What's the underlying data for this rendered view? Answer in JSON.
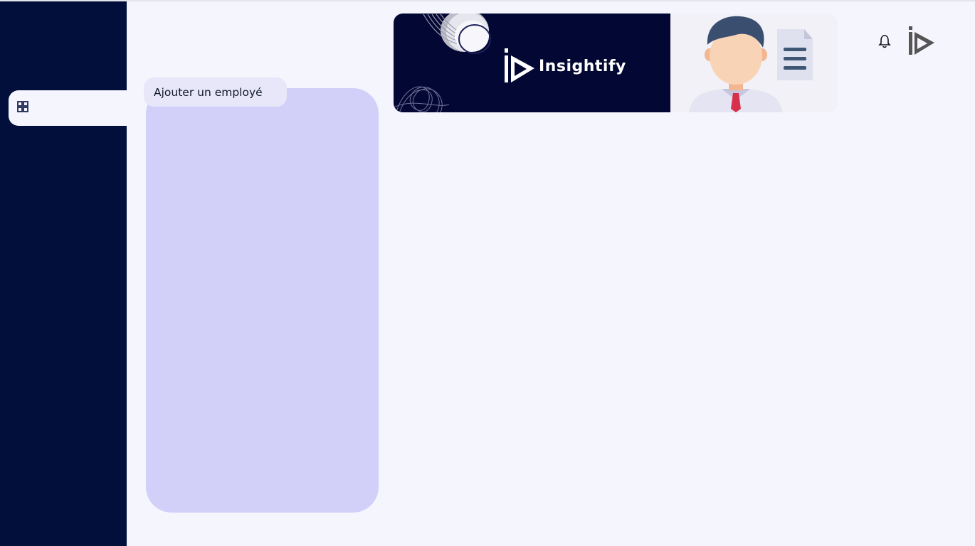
{
  "sidebar": {
    "items": [
      {
        "icon": "dashboard-grid-icon",
        "active": true
      }
    ]
  },
  "main": {
    "add_employee_label": "Ajouter un employé"
  },
  "banner": {
    "brand_name": "Insightify"
  },
  "colors": {
    "sidebar_bg": "#020f3a",
    "page_bg": "#f5f5fe",
    "panel_bg": "#d2d0f9",
    "banner_dark": "#030733"
  }
}
